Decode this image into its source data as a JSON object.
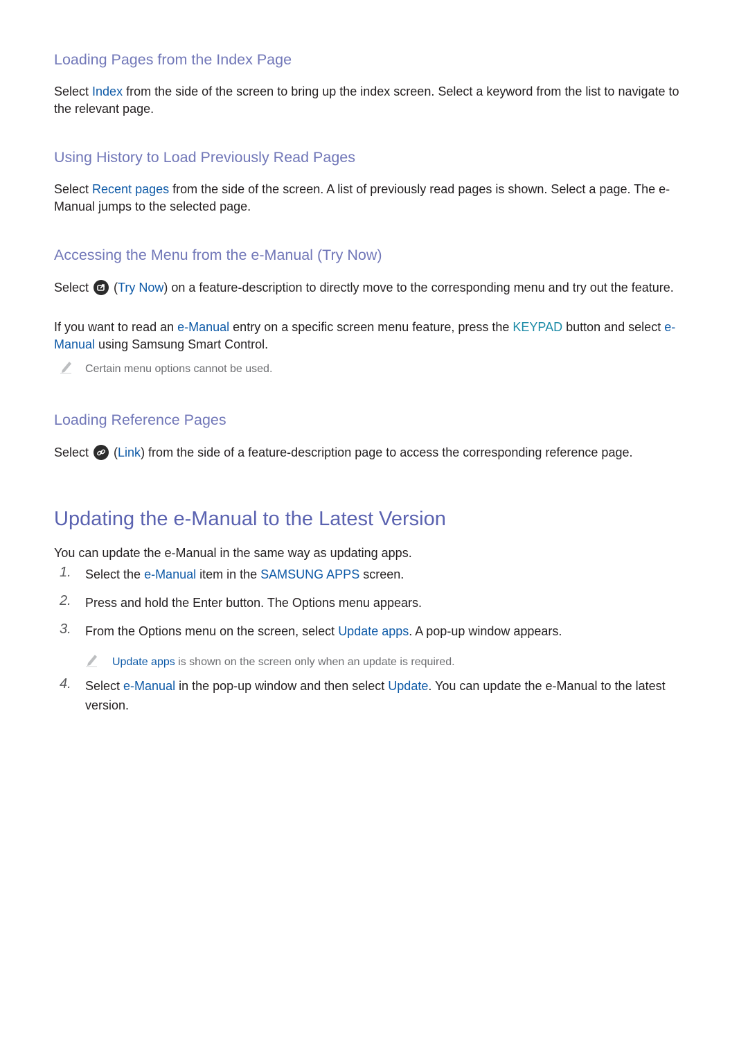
{
  "sections": [
    {
      "heading": "Loading Pages from the Index Page",
      "body": {
        "pre": "Select ",
        "link": "Index",
        "post": " from the side of the screen to bring up the index screen. Select a keyword from the list to navigate to the relevant page."
      }
    },
    {
      "heading": "Using History to Load Previously Read Pages",
      "body": {
        "pre": "Select ",
        "link": "Recent pages",
        "post": " from the side of the screen. A list of previously read pages is shown. Select a page. The e-Manual jumps to the selected page."
      }
    },
    {
      "heading": "Accessing the Menu from the e-Manual (Try Now)",
      "body1": {
        "pre": "Select ",
        "icon": "try-now-icon",
        "open_paren": " (",
        "link": "Try Now",
        "post": ") on a feature-description to directly move to the corresponding menu and try out the feature."
      },
      "body2": {
        "a": "If you want to read an ",
        "link1": "e-Manual",
        "b": " entry on a specific screen menu feature, press the ",
        "key": "KEYPAD",
        "c": " button and select ",
        "link2": "e-Manual",
        "d": " using Samsung Smart Control."
      },
      "note": {
        "icon": "pencil-note-icon",
        "text": "Certain menu options cannot be used."
      }
    },
    {
      "heading": "Loading Reference Pages",
      "body": {
        "pre": "Select ",
        "icon": "link-icon",
        "open_paren": " (",
        "link": "Link",
        "post": ") from the side of a feature-description page to access the corresponding reference page."
      }
    }
  ],
  "update": {
    "heading": "Updating the e-Manual to the Latest Version",
    "intro": "You can update the e-Manual in the same way as updating apps.",
    "steps": [
      {
        "num": "1.",
        "a": "Select the ",
        "link1": "e-Manual",
        "b": " item in the ",
        "link2": "SAMSUNG APPS",
        "c": " screen."
      },
      {
        "num": "2.",
        "text": "Press and hold the Enter button. The Options menu appears."
      },
      {
        "num": "3.",
        "a": "From the Options menu on the screen, select ",
        "link1": "Update apps",
        "b": ". A pop-up window appears."
      },
      {
        "num": "4.",
        "a": "Select ",
        "link1": "e-Manual",
        "b": " in the pop-up window and then select ",
        "link2": "Update",
        "c": ". You can update the e-Manual to the latest version."
      }
    ],
    "note": {
      "icon": "pencil-note-icon",
      "link": "Update apps",
      "text": " is shown on the screen only when an update is required."
    }
  },
  "colors": {
    "subheading": "#7177b8",
    "heading": "#5a62b0",
    "link": "#0e5aa7",
    "keypad": "#1a8aa6",
    "note": "#6d6e71",
    "body": "#231f20"
  }
}
